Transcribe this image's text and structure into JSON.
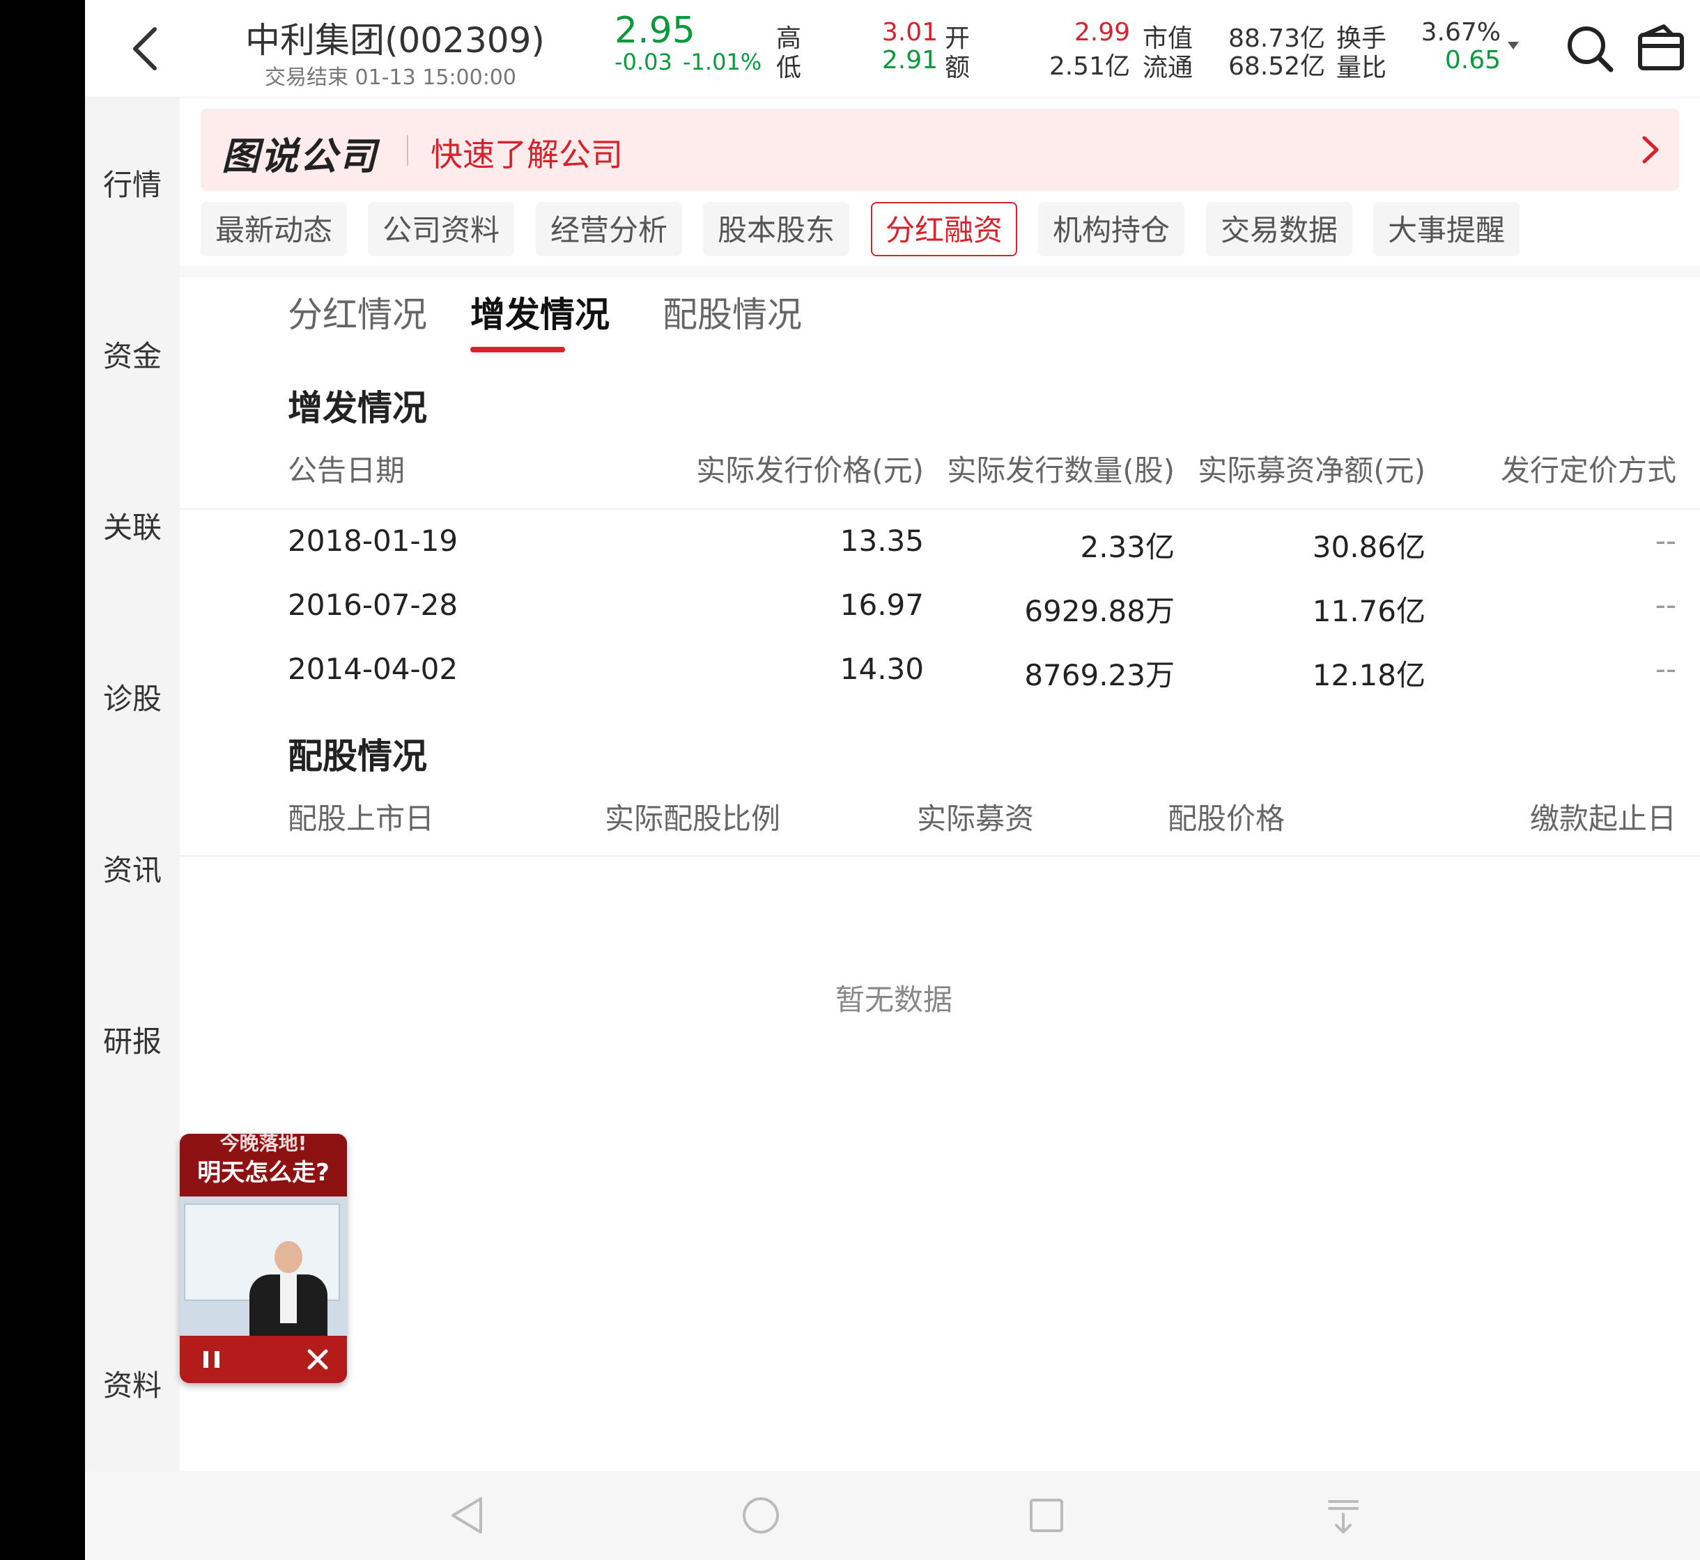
{
  "header": {
    "stock_name": "中利集团(002309)",
    "status": "交易结束 01-13 15:00:00",
    "price": "2.95",
    "change": "-0.03",
    "change_pct": "-1.01%",
    "labels": {
      "high": "高",
      "low": "低",
      "open": "开",
      "amount": "额",
      "mkt_cap": "市值",
      "float": "流通",
      "turnover": "换手",
      "vol_ratio": "量比"
    },
    "values": {
      "high": "3.01",
      "low": "2.91",
      "open": "2.99",
      "amount": "2.51亿",
      "mkt_cap": "88.73亿",
      "float": "68.52亿",
      "turnover": "3.67%",
      "vol_ratio": "0.65"
    }
  },
  "left_nav": [
    "行情",
    "资金",
    "关联",
    "诊股",
    "资讯",
    "研报",
    "资料"
  ],
  "banner": {
    "logo": "图说公司",
    "text": "快速了解公司"
  },
  "chips": [
    "最新动态",
    "公司资料",
    "经营分析",
    "股本股东",
    "分红融资",
    "机构持仓",
    "交易数据",
    "大事提醒"
  ],
  "subtabs": [
    "分红情况",
    "增发情况",
    "配股情况"
  ],
  "issuance": {
    "title": "增发情况",
    "headers": [
      "公告日期",
      "实际发行价格(元)",
      "实际发行数量(股)",
      "实际募资净额(元)",
      "发行定价方式"
    ],
    "rows": [
      [
        "2018-01-19",
        "13.35",
        "2.33亿",
        "30.86亿",
        "--"
      ],
      [
        "2016-07-28",
        "16.97",
        "6929.88万",
        "11.76亿",
        "--"
      ],
      [
        "2014-04-02",
        "14.30",
        "8769.23万",
        "12.18亿",
        "--"
      ]
    ]
  },
  "rights": {
    "title": "配股情况",
    "headers": [
      "配股上市日",
      "实际配股比例",
      "实际募资",
      "配股价格",
      "缴款起止日"
    ],
    "empty": "暂无数据"
  },
  "video": {
    "title_top": "今晚落地!",
    "title": "明天怎么走?"
  },
  "colors": {
    "accent": "#d8212a",
    "down": "#0a9a3c"
  }
}
